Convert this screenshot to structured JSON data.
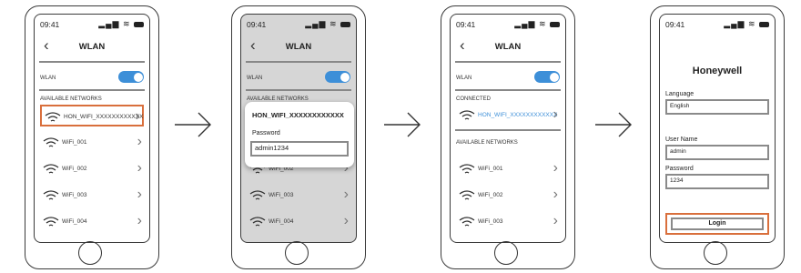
{
  "status": {
    "time": "09:41"
  },
  "screen1": {
    "title": "WLAN",
    "wlan_label": "WLAN",
    "section": "AVAILABLE NETWORKS",
    "networks": [
      "HON_WIFI_XXXXXXXXXXXX",
      "WiFi_001",
      "WiFi_002",
      "WiFi_003",
      "WiFi_004"
    ]
  },
  "screen2": {
    "title": "WLAN",
    "wlan_label": "WLAN",
    "section": "AVAILABLE NETWORKS",
    "networks": [
      "WiFi_002",
      "WiFi_003",
      "WiFi_004"
    ],
    "popup": {
      "ssid": "HON_WIFI_XXXXXXXXXXXX",
      "password_label": "Password",
      "password_value": "admin1234"
    }
  },
  "screen3": {
    "title": "WLAN",
    "wlan_label": "WLAN",
    "connected_label": "CONNECTED",
    "connected_network": "HON_WIFI_XXXXXXXXXXXX",
    "section": "AVAILABLE NETWORKS",
    "networks": [
      "WiFi_001",
      "WiFi_002",
      "WiFi_003"
    ]
  },
  "screen4": {
    "brand": "Honeywell",
    "language_label": "Language",
    "language_value": "English",
    "username_label": "User Name",
    "username_value": "admin",
    "password_label": "Password",
    "password_value": "1234",
    "login_label": "Login"
  },
  "colors": {
    "accent_toggle": "#3d8fd8",
    "highlight": "#d96f3c",
    "connected_text": "#3d8fd8",
    "dim_overlay": "#d6d6d6"
  }
}
